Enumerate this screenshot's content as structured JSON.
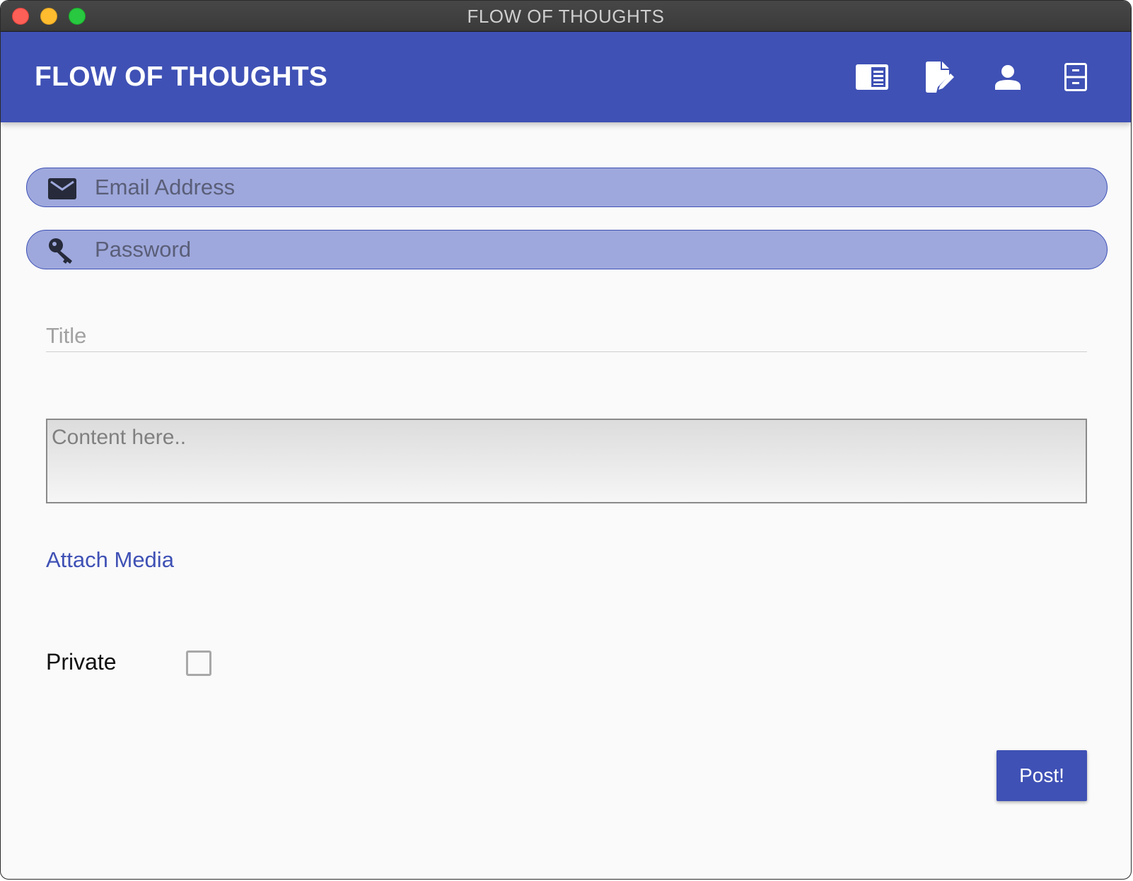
{
  "window": {
    "title": "FLOW OF THOUGHTS"
  },
  "appbar": {
    "title": "FLOW OF THOUGHTS",
    "actions": [
      {
        "icon": "feed-icon"
      },
      {
        "icon": "edit-document-icon"
      },
      {
        "icon": "person-icon"
      },
      {
        "icon": "archive-icon"
      }
    ],
    "color": "#3f51b5"
  },
  "login": {
    "email": {
      "icon": "email-icon",
      "value": "",
      "placeholder": "Email Address"
    },
    "password": {
      "icon": "key-icon",
      "value": "",
      "placeholder": "Password"
    }
  },
  "post_form": {
    "title_placeholder": "Title",
    "content_placeholder": "Content here..",
    "attach_label": "Attach Media",
    "private_label": "Private",
    "private_checked": false,
    "submit_label": "Post!"
  }
}
